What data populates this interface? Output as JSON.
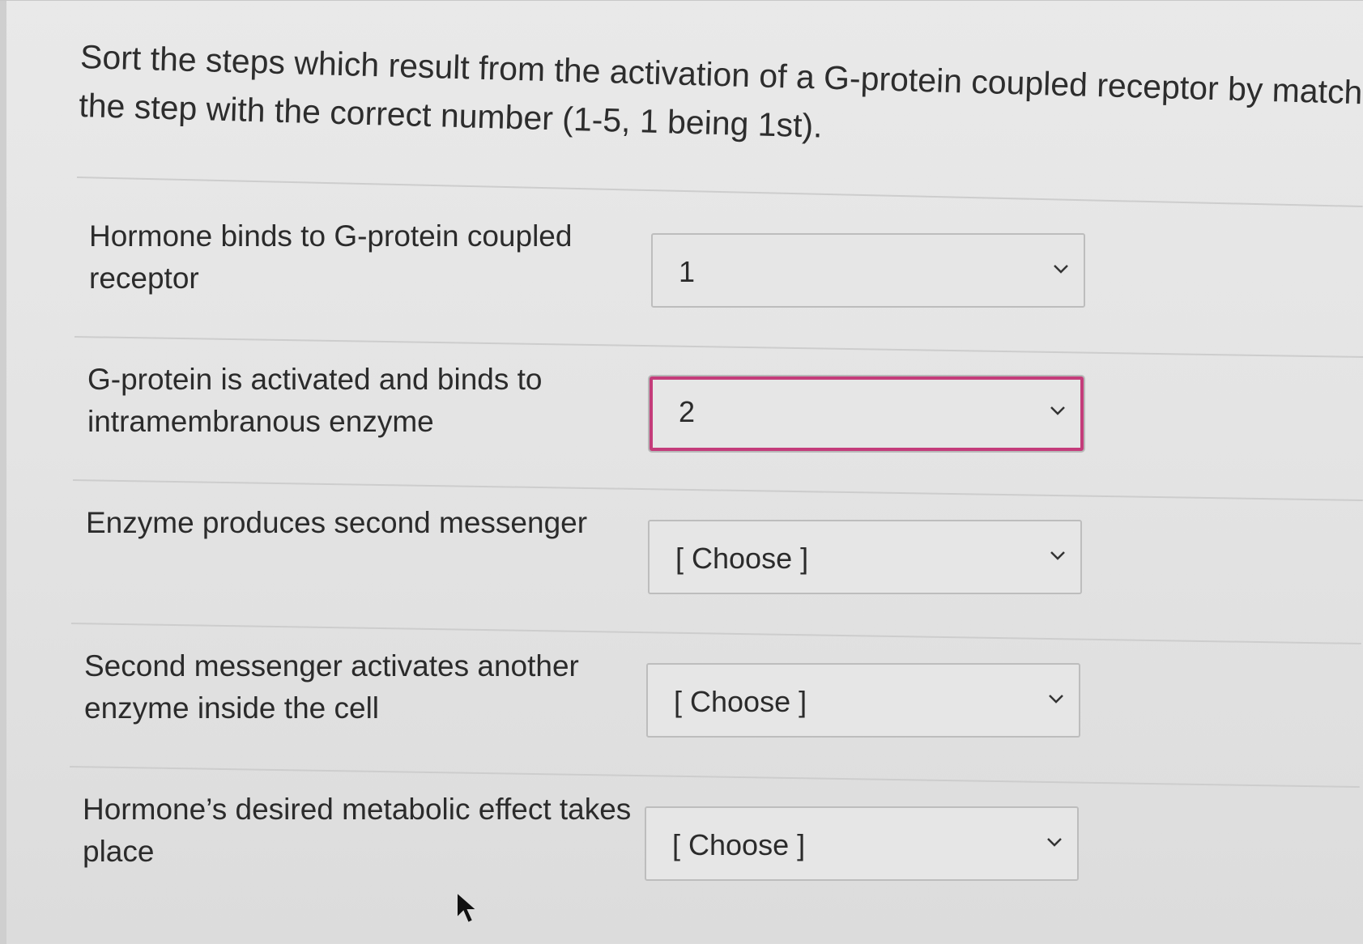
{
  "question": {
    "line1": "Sort the steps which result from the activation of a G-protein coupled receptor by matching",
    "line2": "the step with the correct number (1-5, 1 being 1st)."
  },
  "rows": [
    {
      "label_line1": "Hormone binds to G-protein coupled",
      "label_line2": "receptor",
      "value": "1",
      "focused": false
    },
    {
      "label_line1": "G-protein is activated and binds to",
      "label_line2": "intramembranous enzyme",
      "value": "2",
      "focused": true
    },
    {
      "label_line1": "Enzyme produces second messenger",
      "label_line2": "",
      "value": "[ Choose ]",
      "focused": false
    },
    {
      "label_line1": "Second messenger activates another",
      "label_line2": "enzyme inside the cell",
      "value": "[ Choose ]",
      "focused": false
    },
    {
      "label_line1": "Hormone’s desired metabolic effect takes",
      "label_line2": "place",
      "value": "[ Choose ]",
      "focused": false
    }
  ],
  "icons": {
    "dropdown": "chevron-down-icon",
    "cursor": "mouse-pointer-icon"
  },
  "colors": {
    "focus_border": "#c43c7a",
    "background": "#e6e6e6",
    "text": "#2b2b2b"
  }
}
